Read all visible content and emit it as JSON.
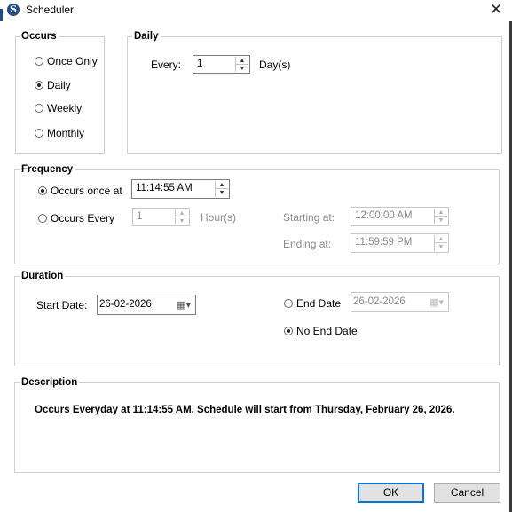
{
  "window": {
    "title": "Scheduler",
    "app_icon_letter": "S"
  },
  "occurs": {
    "legend": "Occurs",
    "options": [
      {
        "label": "Once Only",
        "selected": false
      },
      {
        "label": "Daily",
        "selected": true
      },
      {
        "label": "Weekly",
        "selected": false
      },
      {
        "label": "Monthly",
        "selected": false
      }
    ]
  },
  "daily": {
    "legend": "Daily",
    "every_label": "Every:",
    "every_value": "1",
    "unit_label": "Day(s)"
  },
  "frequency": {
    "legend": "Frequency",
    "once_label": "Occurs once at",
    "once_time": "11:14:55 AM",
    "every_label": "Occurs Every",
    "every_value": "1",
    "every_unit": "Hour(s)",
    "starting_label": "Starting at:",
    "starting_value": "12:00:00 AM",
    "ending_label": "Ending at:",
    "ending_value": "11:59:59 PM"
  },
  "duration": {
    "legend": "Duration",
    "start_label": "Start Date:",
    "start_value": "26-02-2026",
    "end_label": "End Date",
    "end_value": "26-02-2026",
    "no_end_label": "No End Date"
  },
  "description": {
    "legend": "Description",
    "text": "Occurs Everyday at 11:14:55 AM. Schedule will start from Thursday, February 26, 2026."
  },
  "buttons": {
    "ok": "OK",
    "cancel": "Cancel"
  },
  "icons": {
    "close": "close-icon",
    "calendar": "calendar-icon",
    "app": "scheduler-app-icon"
  }
}
